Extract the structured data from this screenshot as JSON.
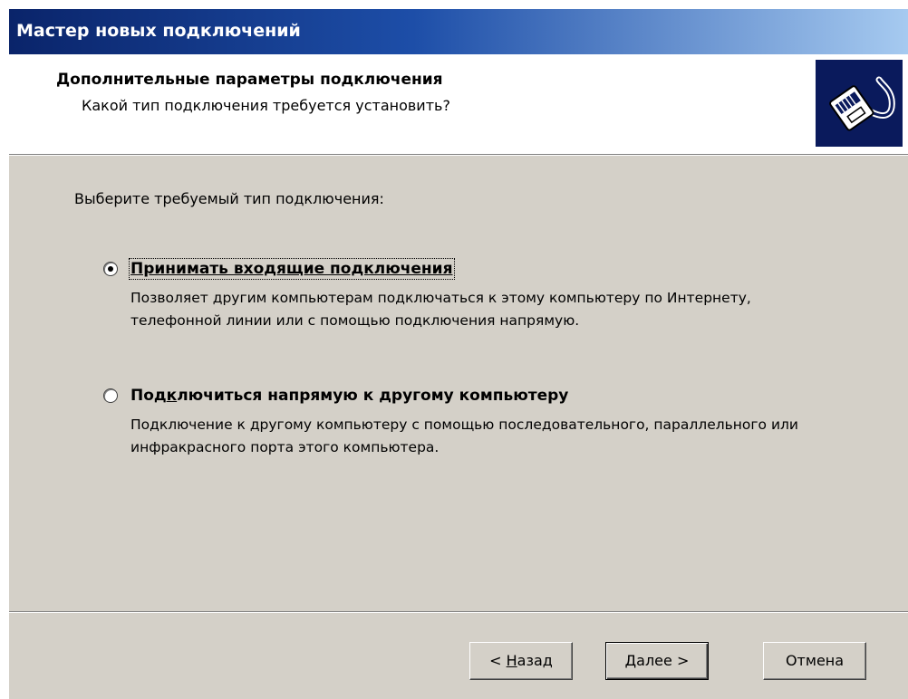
{
  "window": {
    "title": "Мастер новых подключений"
  },
  "header": {
    "title": "Дополнительные параметры подключения",
    "subtitle": "Какой тип подключения требуется установить?",
    "logo_icon": "network-plug-icon"
  },
  "body": {
    "prompt": "Выберите требуемый тип подключения:",
    "options": [
      {
        "label": "Принимать входящие подключения",
        "description": "Позволяет другим компьютерам подключаться к этому компьютеру по Интернету, телефонной линии или с помощью подключения напрямую.",
        "selected": true
      },
      {
        "label_before": "Под",
        "label_accel": "к",
        "label_after": "лючиться напрямую к другому компьютеру",
        "description": "Подключение к другому компьютеру с помощью последовательного, параллельного или инфракрасного порта этого компьютера.",
        "selected": false
      }
    ]
  },
  "buttons": {
    "back_prefix": "< ",
    "back_accel": "Н",
    "back_rest": "азад",
    "next_accel": "Д",
    "next_rest": "алее >",
    "cancel": "Отмена"
  },
  "colors": {
    "titlebar_start": "#0a246a",
    "titlebar_end": "#a6caf0",
    "dialog_face": "#d4d0c8",
    "logo_bg": "#0a1a5c"
  }
}
